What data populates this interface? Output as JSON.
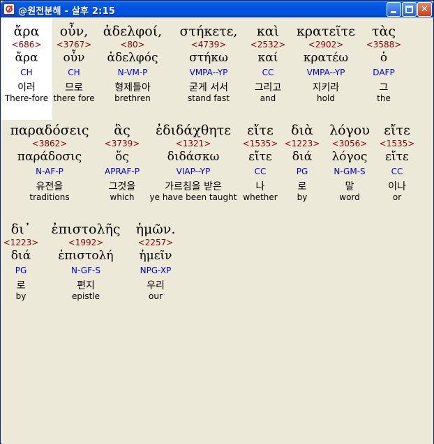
{
  "window": {
    "title": "@원전분해 - 살후 2:15",
    "controls": {
      "minimize": "minimize",
      "maximize": "maximize",
      "close": "close"
    }
  },
  "verse_rows": [
    {
      "words": [
        {
          "greek": "ἄρα",
          "strong": "<686>",
          "lemma": "ἄρα",
          "morph": "CH",
          "korean": "이러",
          "english": "There-fore"
        },
        {
          "greek": "οὖν,",
          "strong": "<3767>",
          "lemma": "οὖν",
          "morph": "CH",
          "korean": "므로",
          "english": "there fore"
        },
        {
          "greek": "ἀδελφοί,",
          "strong": "<80>",
          "lemma": "ἀδελφός",
          "morph": "N-VM-P",
          "korean": "형제들아",
          "english": "brethren"
        },
        {
          "greek": "στήκετε,",
          "strong": "<4739>",
          "lemma": "στήκω",
          "morph": "VMPA--YP",
          "korean": "굳게 서서",
          "english": "stand fast"
        },
        {
          "greek": "καὶ",
          "strong": "<2532>",
          "lemma": "καί",
          "morph": "CC",
          "korean": "그리고",
          "english": "and"
        },
        {
          "greek": "κρατεῖτε",
          "strong": "<2902>",
          "lemma": "κρατέω",
          "morph": "VMPA--YP",
          "korean": "지키라",
          "english": "hold"
        },
        {
          "greek": "τὰς",
          "strong": "<3588>",
          "lemma": "ὁ",
          "morph": "DAFP",
          "korean": "그",
          "english": "the"
        }
      ]
    },
    {
      "words": [
        {
          "greek": "παραδόσεις",
          "strong": "<3862>",
          "lemma": "παράδοσις",
          "morph": "N-AF-P",
          "korean": "유전을",
          "english": "traditions"
        },
        {
          "greek": "ἃς",
          "strong": "<3739>",
          "lemma": "ὅς",
          "morph": "APRAF-P",
          "korean": "그것을",
          "english": "which"
        },
        {
          "greek": "ἐδιδάχθητε",
          "strong": "<1321>",
          "lemma": "διδάσκω",
          "morph": "VIAP--YP",
          "korean": "가르침을 받은",
          "english": "ye have been taught"
        },
        {
          "greek": "εἴτε",
          "strong": "<1535>",
          "lemma": "εἴτε",
          "morph": "CC",
          "korean": "나",
          "english": "whether"
        },
        {
          "greek": "διὰ",
          "strong": "<1223>",
          "lemma": "διά",
          "morph": "PG",
          "korean": "로",
          "english": "by"
        },
        {
          "greek": "λόγου",
          "strong": "<3056>",
          "lemma": "λόγος",
          "morph": "N-GM-S",
          "korean": "말",
          "english": "word"
        },
        {
          "greek": "εἴτε",
          "strong": "<1535>",
          "lemma": "εἴτε",
          "morph": "CC",
          "korean": "이나",
          "english": "or"
        }
      ]
    },
    {
      "words": [
        {
          "greek": "δι᾽",
          "strong": "<1223>",
          "lemma": "διά",
          "morph": "PG",
          "korean": "로",
          "english": "by"
        },
        {
          "greek": "ἐπιστολῆς",
          "strong": "<1992>",
          "lemma": "ἐπιστολή",
          "morph": "N-GF-S",
          "korean": "편지",
          "english": "epistle"
        },
        {
          "greek": "ἡμῶν.",
          "strong": "<2257>",
          "lemma": "ἡμεῖν",
          "morph": "NPG-XP",
          "korean": "우리",
          "english": "our"
        }
      ]
    }
  ],
  "colors": {
    "strong_number": "#8b0000",
    "morphology": "#0000cc",
    "client_bg": "#ece9d8",
    "title_bar": "#0054e3"
  }
}
